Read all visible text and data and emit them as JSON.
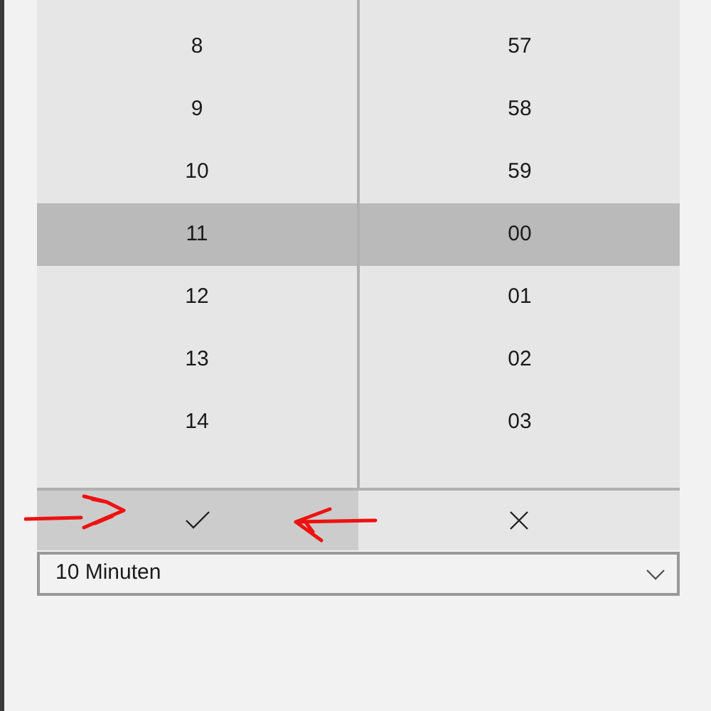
{
  "picker": {
    "columns": [
      {
        "items": [
          {
            "label": "8",
            "selected": false
          },
          {
            "label": "9",
            "selected": false
          },
          {
            "label": "10",
            "selected": false
          },
          {
            "label": "11",
            "selected": true
          },
          {
            "label": "12",
            "selected": false
          },
          {
            "label": "13",
            "selected": false
          },
          {
            "label": "14",
            "selected": false
          }
        ]
      },
      {
        "items": [
          {
            "label": "57",
            "selected": false
          },
          {
            "label": "58",
            "selected": false
          },
          {
            "label": "59",
            "selected": false
          },
          {
            "label": "00",
            "selected": true
          },
          {
            "label": "01",
            "selected": false
          },
          {
            "label": "02",
            "selected": false
          },
          {
            "label": "03",
            "selected": false
          }
        ]
      }
    ],
    "buttons": [
      {
        "kind": "accept",
        "highlighted": true
      },
      {
        "kind": "cancel",
        "highlighted": false
      }
    ],
    "annotations": [
      {
        "kind": "arrow_right"
      },
      {
        "kind": "arrow_left"
      }
    ]
  },
  "dropdown": {
    "value": "10 Minuten"
  }
}
